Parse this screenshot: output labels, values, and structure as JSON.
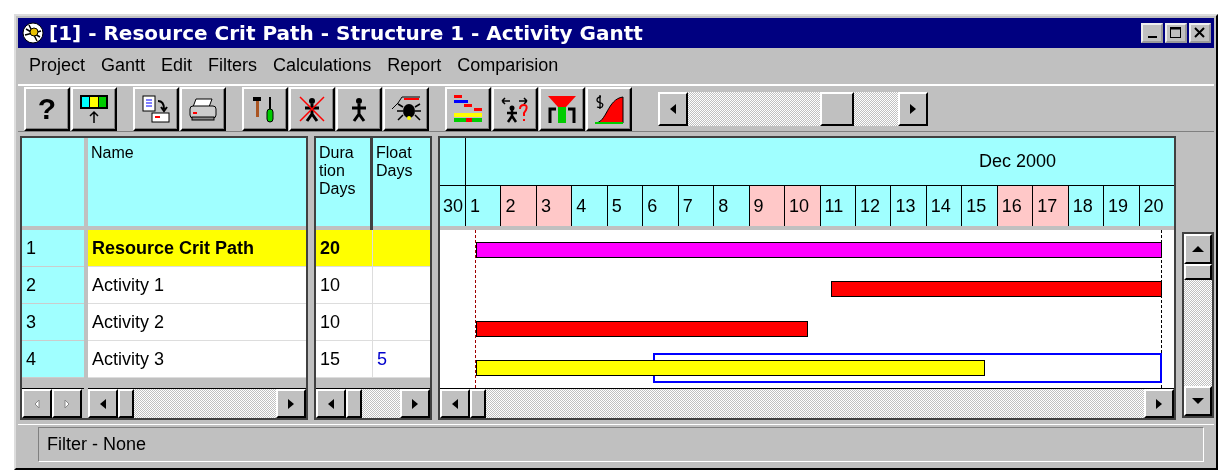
{
  "window": {
    "title": "[1] - Resource Crit Path - Structure 1 - Activity Gantt"
  },
  "menu": [
    "Project",
    "Gantt",
    "Edit",
    "Filters",
    "Calculations",
    "Report",
    "Comparision"
  ],
  "toolbar": {
    "help_label": "?"
  },
  "table": {
    "columns": [
      {
        "label": "Name"
      },
      {
        "label": "Duration Days"
      },
      {
        "label": "Float Days"
      }
    ],
    "rows": [
      {
        "number": "1",
        "name": "Resource Crit Path",
        "duration": "20",
        "summary": true,
        "bar": {
          "kind": "summary"
        }
      },
      {
        "number": "2",
        "name": "Activity 1",
        "duration": "10",
        "summary": false,
        "bar": {
          "kind": "critical"
        }
      },
      {
        "number": "3",
        "name": "Activity 2",
        "duration": "10",
        "summary": false,
        "bar": {
          "kind": "critical"
        }
      },
      {
        "number": "4",
        "name": "Activity 3",
        "duration": "15",
        "float": "5",
        "summary": false,
        "bar": {
          "kind": "normal",
          "float": true
        }
      }
    ]
  },
  "gantt": {
    "month": "Dec 2000",
    "previous_day": "30",
    "days": [
      {
        "label": "1",
        "weekend": false
      },
      {
        "label": "2",
        "weekend": true
      },
      {
        "label": "3",
        "weekend": true
      },
      {
        "label": "4",
        "weekend": false
      },
      {
        "label": "5",
        "weekend": false
      },
      {
        "label": "6",
        "weekend": false
      },
      {
        "label": "7",
        "weekend": false
      },
      {
        "label": "8",
        "weekend": false
      },
      {
        "label": "9",
        "weekend": true
      },
      {
        "label": "10",
        "weekend": true
      },
      {
        "label": "11",
        "weekend": false
      },
      {
        "label": "12",
        "weekend": false
      },
      {
        "label": "13",
        "weekend": false
      },
      {
        "label": "14",
        "weekend": false
      },
      {
        "label": "15",
        "weekend": false
      },
      {
        "label": "16",
        "weekend": true
      },
      {
        "label": "17",
        "weekend": true
      },
      {
        "label": "18",
        "weekend": false
      },
      {
        "label": "19",
        "weekend": false
      },
      {
        "label": "20",
        "weekend": false
      }
    ]
  },
  "status_bar": {
    "text": "Filter - None"
  }
}
